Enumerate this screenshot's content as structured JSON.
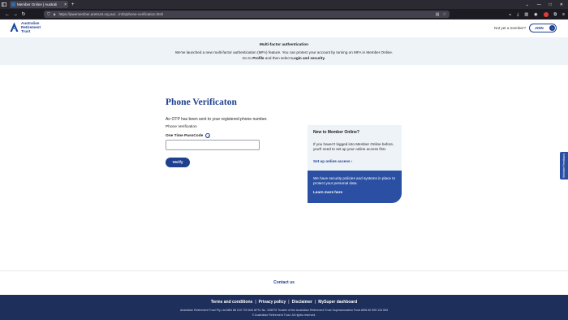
{
  "browser": {
    "tab_title": "Member Online | Australi",
    "tab_close": "×",
    "new_tab": "+",
    "url": "https://pwemember.aretrust.org.au/.../mfa/phone-verification.html"
  },
  "header": {
    "logo_line1": "Australian",
    "logo_line2": "Retirement",
    "logo_line3": "Trust",
    "member_question": "Not yet a member?",
    "join_label": "JOIN",
    "join_arrow": "›"
  },
  "mfa_banner": {
    "title": "Multi-factor authentication",
    "line1": "We've launched a new multi-factor authentication (MFA) feature. You can protect your account by turning on MFA in Member Online.",
    "line2_pre": "Go to ",
    "line2_profile": "Profile",
    "line2_mid": " and then select ",
    "line2_login": "Login and security",
    "line2_end": "."
  },
  "form": {
    "heading": "Phone Verificaton",
    "otp_sent": "An OTP has been sent to your registered phone number.",
    "phone_verification": "Phone Verification",
    "otp_label": "One Time PassCode",
    "info_glyph": "i",
    "otp_value": "",
    "verify_label": "Verify"
  },
  "side_panel": {
    "title": "New to Member Online?",
    "text": "If you haven't logged into Member Online before, you'll need to set up your online access first.",
    "setup_link": "Set up online access ›",
    "security_text": "We have security policies and systems in place to protect your personal data.",
    "learn_more": "Learn more here"
  },
  "feedback_tab": "Website Feedback",
  "footer": {
    "contact_us": "Contact us",
    "links": [
      "Terms and conditions",
      "Privacy policy",
      "Disclaimer",
      "MySuper dashboard"
    ],
    "separator": "|",
    "legal1": "Australian Retirement Trust Pty Ltd ABN 88 010 720 840 AFSL No. 228975 Trustee of the Australian Retirement Trust Superannuation Fund ABN 60 905 115 063",
    "legal2": "© Australian Retirement Trust. All rights reserved."
  }
}
